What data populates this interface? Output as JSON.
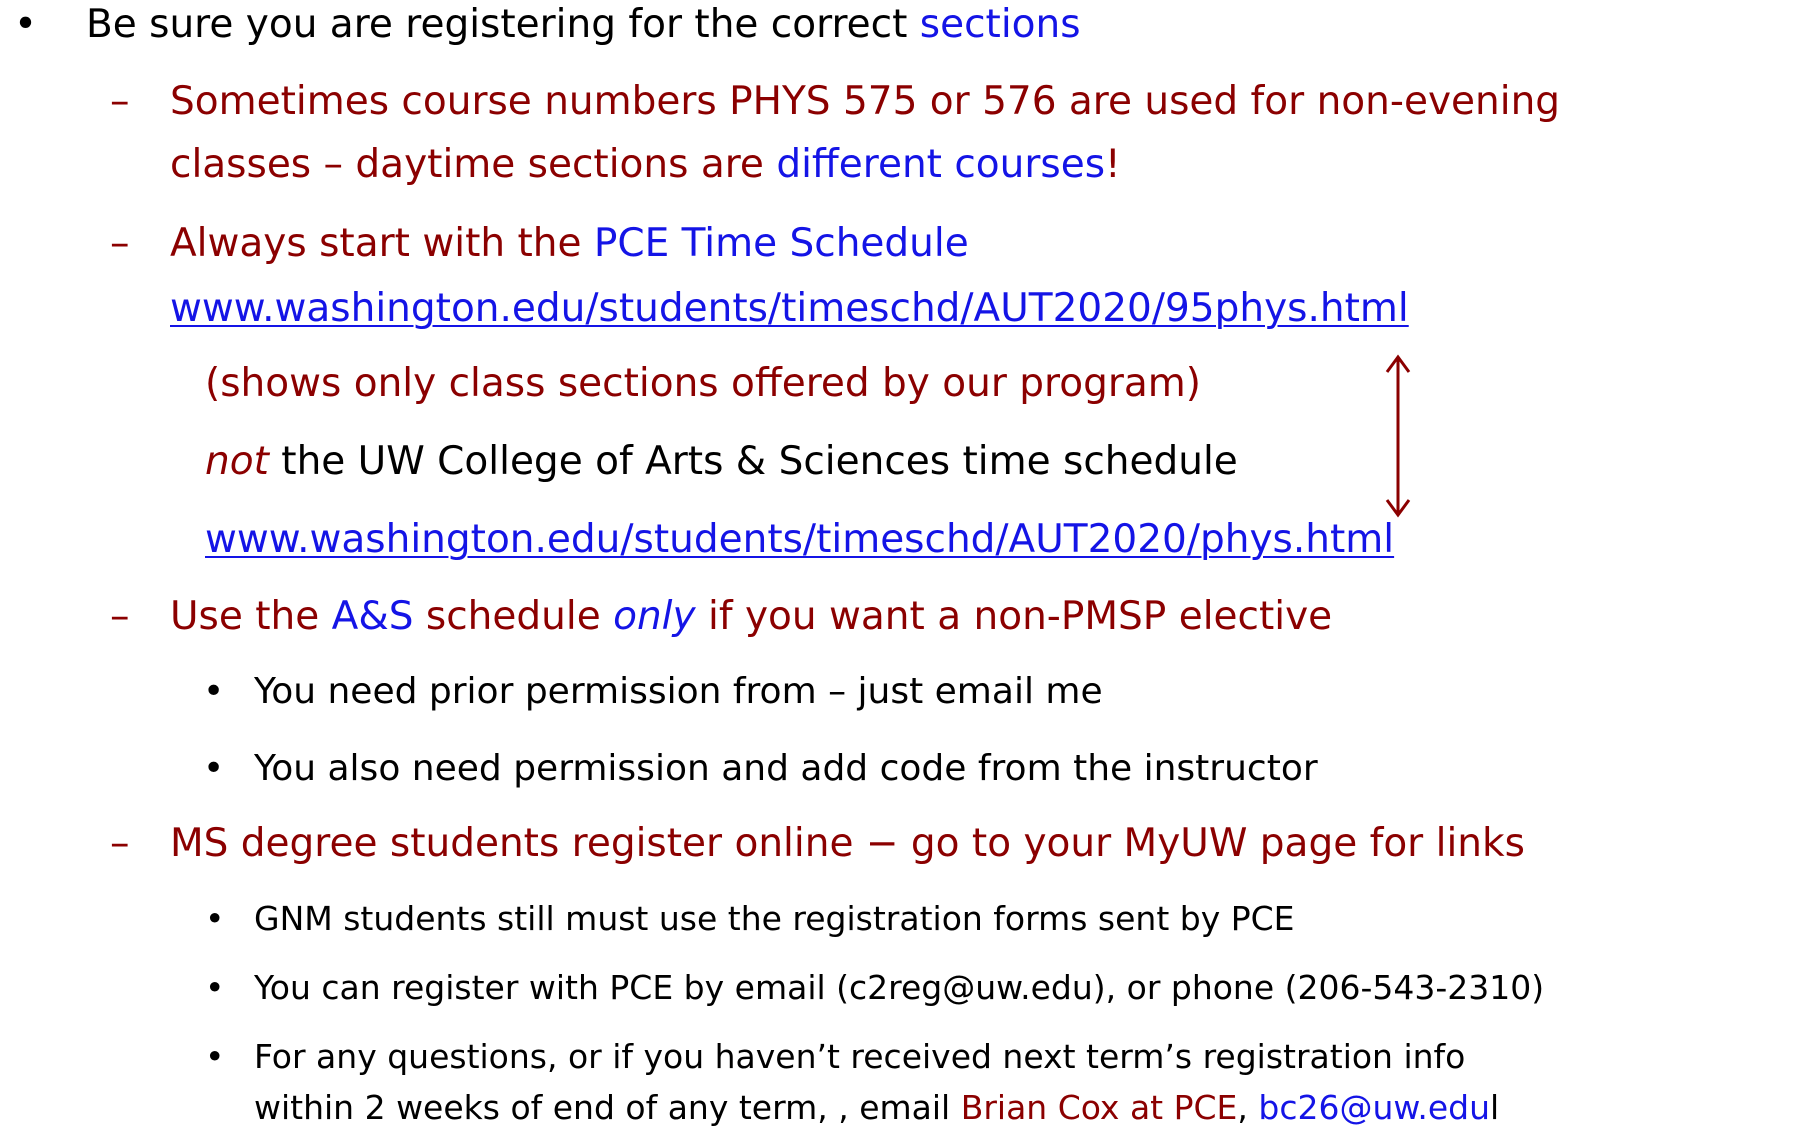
{
  "bullet_glyph": "•",
  "dash_glyph": "–",
  "colors": {
    "black": "#000000",
    "dark_red": "#8B0000",
    "blue": "#1414E6"
  },
  "item1": {
    "text": "Be sure you are registering for the correct ",
    "link": "sections"
  },
  "item1a": {
    "line1": "Sometimes course numbers PHYS 575 or 576 are used for non-evening",
    "line2_a": "classes – daytime sections are ",
    "line2_b": "different courses",
    "line2_c": "!"
  },
  "item1b": {
    "a": "Always start with the ",
    "b": "PCE Time Schedule",
    "url1": "www.washington.edu/students/timeschd/AUT2020/95phys.html",
    "note": "(shows only class sections offered by our program)",
    "not": "not",
    "not_rest": " the UW College of Arts & Sciences time schedule",
    "url2": "www.washington.edu/students/timeschd/AUT2020/phys.html"
  },
  "item1c": {
    "a": "Use the ",
    "b": "A&S",
    "c": " schedule ",
    "d": "only",
    "e": " if you want a non-PMSP elective",
    "sub1": "You need prior permission from – just email me",
    "sub2": "You also need permission and add code from the instructor"
  },
  "item1d": {
    "text": "MS degree students register online − go to your MyUW page for links",
    "sub1": "GNM students still must use the registration forms sent by PCE",
    "sub2": "You can register with PCE by email (c2reg@uw.edu), or phone (206-543-2310)",
    "sub3_line1": "For any questions, or if you haven’t received next term’s registration info",
    "sub3_line2_a": "within 2 weeks of end of any term, , email ",
    "sub3_line2_b": "Brian Cox at PCE",
    "sub3_line2_c": ", ",
    "sub3_line2_d": "bc26@uw.edu",
    "sub3_line2_e": "l"
  }
}
